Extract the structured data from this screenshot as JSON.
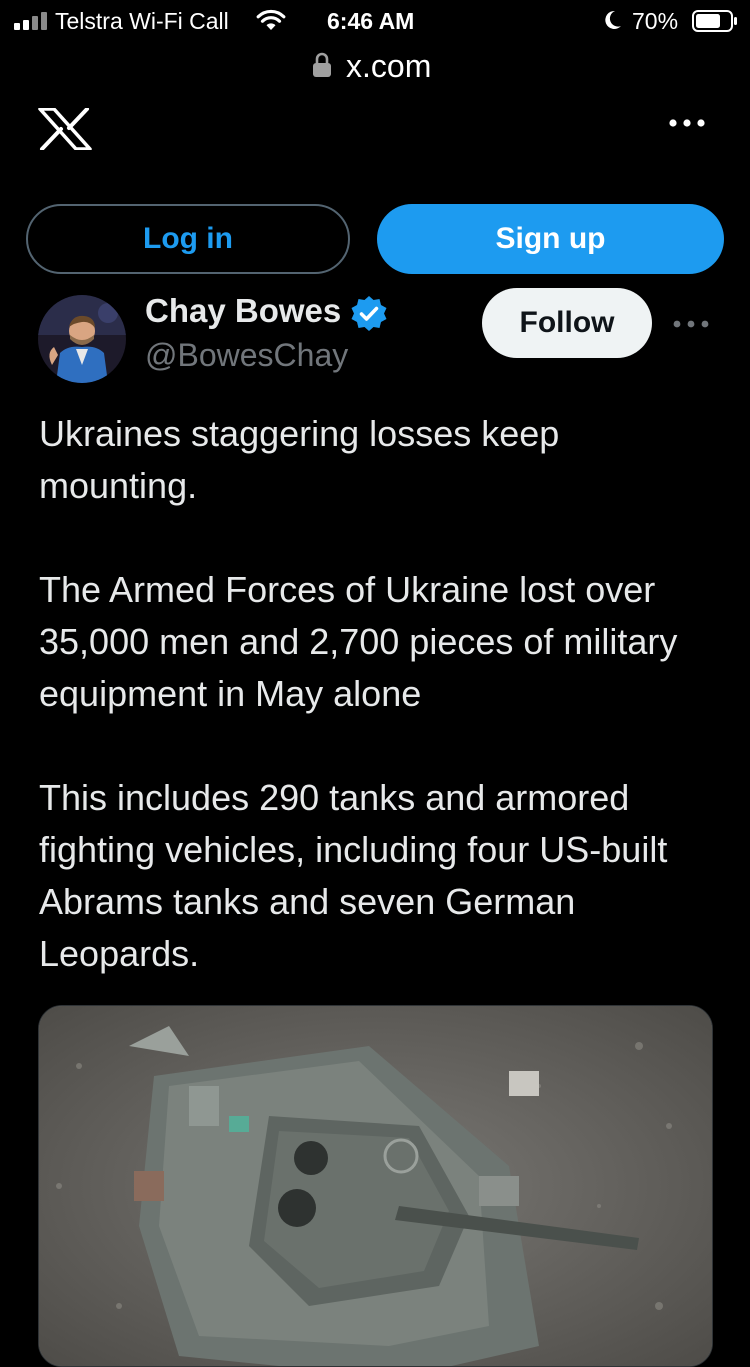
{
  "status_bar": {
    "carrier": "Telstra Wi-Fi Call",
    "time": "6:46 AM",
    "battery": "70%"
  },
  "browser": {
    "url": "x.com"
  },
  "auth": {
    "login_label": "Log in",
    "signup_label": "Sign up"
  },
  "post": {
    "author_name": "Chay Bowes",
    "author_handle": "@BowesChay",
    "follow_label": "Follow",
    "paragraphs": [
      "Ukraines staggering losses keep mounting.",
      "The Armed Forces of Ukraine lost over 35,000 men and 2,700 pieces of military equipment in May alone",
      "This includes 290 tanks and armored fighting vehicles, including four US-built Abrams tanks and seven German Leopards."
    ]
  },
  "colors": {
    "accent": "#1d9bf0",
    "background": "#000000",
    "text": "#e7e9ea",
    "muted": "#71767b"
  },
  "icons": [
    "signal-icon",
    "wifi-icon",
    "moon-icon",
    "battery-icon",
    "lock-icon",
    "x-logo-icon",
    "more-icon",
    "verified-badge-icon"
  ]
}
